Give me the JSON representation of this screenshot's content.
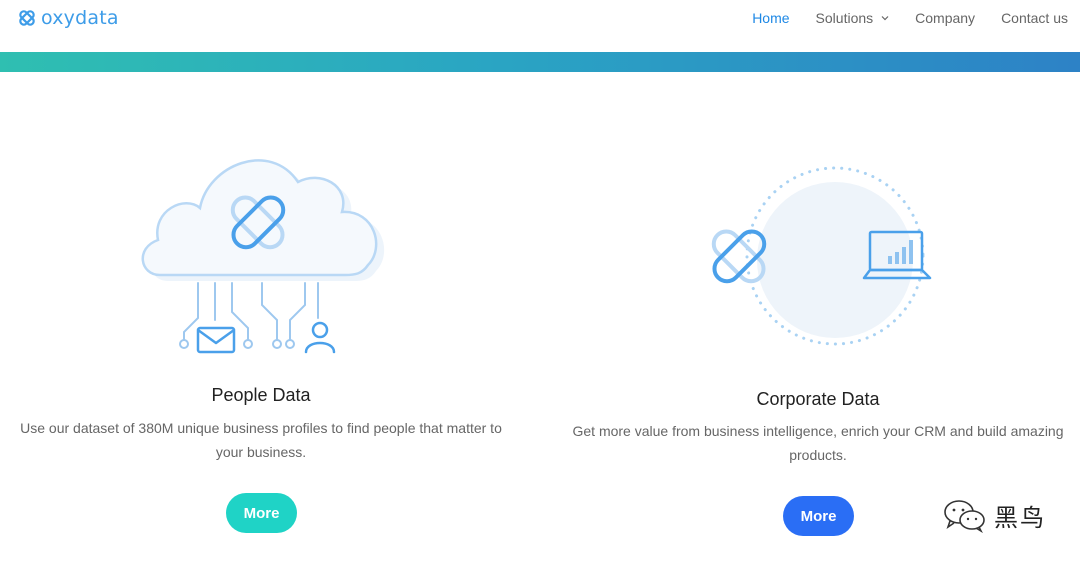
{
  "brand": {
    "name": "oxydata"
  },
  "nav": {
    "home": "Home",
    "solutions": "Solutions",
    "company": "Company",
    "contact": "Contact us"
  },
  "cards": {
    "people": {
      "title": "People Data",
      "description_line1": "Use our dataset of 380M unique business profiles to find people that matter to",
      "description_line2": "your business.",
      "button": "More"
    },
    "corporate": {
      "title": "Corporate Data",
      "description_line1": "Get more value from business intelligence, enrich your CRM and build amazing",
      "description_line2": "products.",
      "button": "More"
    }
  },
  "watermark": {
    "text": "黑鸟"
  },
  "colors": {
    "accent": "#1e88e5",
    "teal_button": "#1fd3c6",
    "blue_button": "#2a6ef5",
    "gradient_start": "#2fbfb1",
    "gradient_end": "#2d82c6"
  },
  "icons": {
    "logo": "logo-knot-icon",
    "solutions_dropdown": "chevron-down-icon",
    "people": "cloud-network-icon",
    "corporate": "laptop-chart-icon",
    "watermark": "wechat-icon"
  }
}
